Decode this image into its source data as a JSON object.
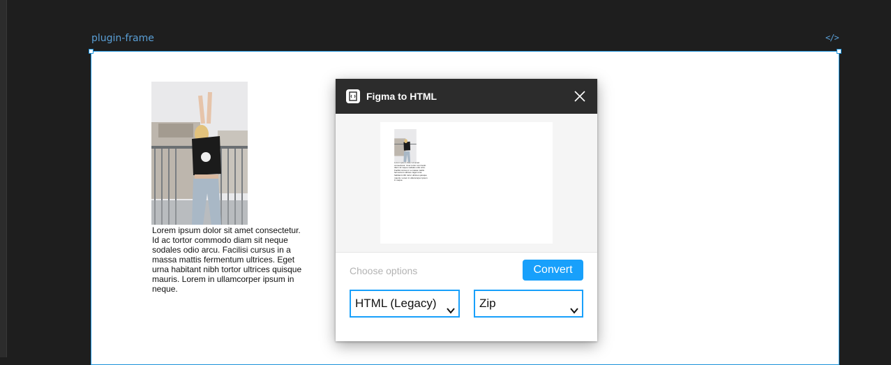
{
  "canvas": {
    "frame_label": "plugin-frame",
    "code_icon": "code-icon",
    "lorem_text": "Lorem ipsum dolor sit amet consectetur. Id ac tortor commodo diam sit neque sodales odio arcu. Facilisi cursus in a massa mattis fermentum ultrices. Eget urna habitant nibh tortor ultrices quisque mauris. Lorem in ullamcorper ipsum in neque."
  },
  "dialog": {
    "title": "Figma to HTML",
    "close_icon": "close-icon",
    "options_label": "Choose options",
    "convert_label": "Convert",
    "format_select": {
      "value": "HTML (Legacy)"
    },
    "export_select": {
      "value": "Zip"
    }
  },
  "colors": {
    "accent": "#18a0fb",
    "frame_border": "#1a91da",
    "header_bg": "#2c2c2c",
    "canvas_bg": "#1e1e1e"
  }
}
